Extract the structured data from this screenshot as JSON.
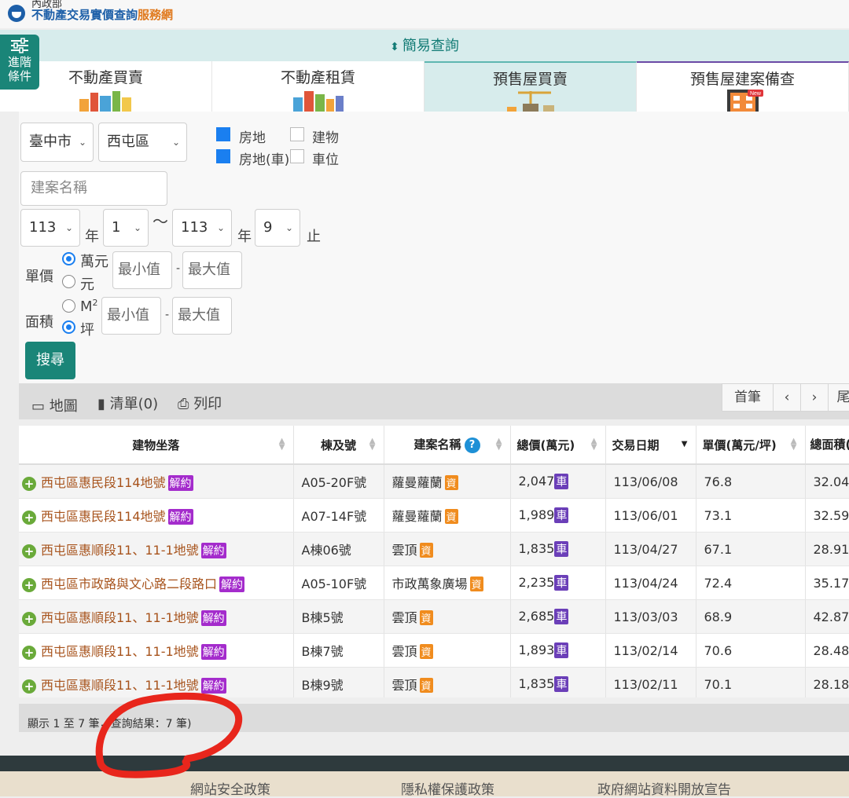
{
  "header": {
    "ministry": "內政部",
    "title_main": "不動產交易實價查詢",
    "title_accent": "服務網"
  },
  "simple_query": {
    "label": "簡易查詢",
    "icon": "sort-arrows-icon"
  },
  "advanced_button": {
    "label_line1": "進階",
    "label_line2": "條件",
    "icon": "sliders-icon"
  },
  "tabs": [
    {
      "label": "不動產買賣",
      "active": false
    },
    {
      "label": "不動產租賃",
      "active": false
    },
    {
      "label": "預售屋買賣",
      "active": true
    },
    {
      "label": "預售屋建案備查",
      "active": false,
      "badge": "New"
    }
  ],
  "form": {
    "city": "臺中市",
    "district": "西屯區",
    "checkboxes": [
      {
        "label": "房地",
        "checked": true
      },
      {
        "label": "建物",
        "checked": false
      },
      {
        "label": "房地(車)",
        "checked": true
      },
      {
        "label": "車位",
        "checked": false
      }
    ],
    "project_name_placeholder": "建案名稱",
    "date_from_year": "113",
    "date_from_month": "1",
    "date_to_year": "113",
    "date_to_month": "9",
    "year_label": "年",
    "tilde": "〜",
    "end_label": "止",
    "unit_price": {
      "label": "單價",
      "options": [
        {
          "label": "萬元",
          "selected": true
        },
        {
          "label": "元",
          "selected": false
        }
      ],
      "min_placeholder": "最小值",
      "max_placeholder": "最大值",
      "dash": "-"
    },
    "area": {
      "label": "面積",
      "options": [
        {
          "label": "M",
          "sup": "2",
          "selected": false
        },
        {
          "label": "坪",
          "selected": true
        }
      ],
      "min_placeholder": "最小值",
      "max_placeholder": "最大值",
      "dash": "-"
    },
    "search_button": "搜尋"
  },
  "toolbar": {
    "map": "地圖",
    "list": "清單(0)",
    "print": "列印",
    "pager": {
      "first": "首筆",
      "prev": "‹",
      "next": "›",
      "last": "尾"
    }
  },
  "table": {
    "columns": [
      {
        "label": "建物坐落"
      },
      {
        "label": "棟及號"
      },
      {
        "label": "建案名稱"
      },
      {
        "label": "總價(萬元)"
      },
      {
        "label": "交易日期"
      },
      {
        "label": "單價(萬元/坪)"
      },
      {
        "label": "總面積(坪)"
      }
    ],
    "tags": {
      "contract": "解約",
      "info": "資",
      "car": "車"
    },
    "rows": [
      {
        "address": "西屯區惠民段114地號",
        "unit": "A05-20F號",
        "project": "蘿曼蘿蘭",
        "total": "2,047",
        "date": "113/06/08",
        "price": "76.8",
        "area": "32.04"
      },
      {
        "address": "西屯區惠民段114地號",
        "unit": "A07-14F號",
        "project": "蘿曼蘿蘭",
        "total": "1,989",
        "date": "113/06/01",
        "price": "73.1",
        "area": "32.59"
      },
      {
        "address": "西屯區惠順段11、11-1地號",
        "unit": "A棟06號",
        "project": "雲頂",
        "total": "1,835",
        "date": "113/04/27",
        "price": "67.1",
        "area": "28.91"
      },
      {
        "address": "西屯區市政路與文心路二段路口",
        "unit": "A05-10F號",
        "project": "市政萬象廣場",
        "total": "2,235",
        "date": "113/04/24",
        "price": "72.4",
        "area": "35.17"
      },
      {
        "address": "西屯區惠順段11、11-1地號",
        "unit": "B棟5號",
        "project": "雲頂",
        "total": "2,685",
        "date": "113/03/03",
        "price": "68.9",
        "area": "42.87"
      },
      {
        "address": "西屯區惠順段11、11-1地號",
        "unit": "B棟7號",
        "project": "雲頂",
        "total": "1,893",
        "date": "113/02/14",
        "price": "70.6",
        "area": "28.48"
      },
      {
        "address": "西屯區惠順段11、11-1地號",
        "unit": "B棟9號",
        "project": "雲頂",
        "total": "1,835",
        "date": "113/02/11",
        "price": "70.1",
        "area": "28.18"
      }
    ]
  },
  "summary": "顯示 1 至 7 筆，查詢結果：7 筆)",
  "footer": {
    "links": [
      "網站安全政策",
      "隱私權保護政策",
      "政府網站資料開放宣告"
    ]
  },
  "colors": {
    "accent": "#1a8578",
    "brand": "#1d5fa8",
    "address": "#a7531c",
    "contract_tag": "#a42ccc",
    "annotation": "#e8261c"
  }
}
